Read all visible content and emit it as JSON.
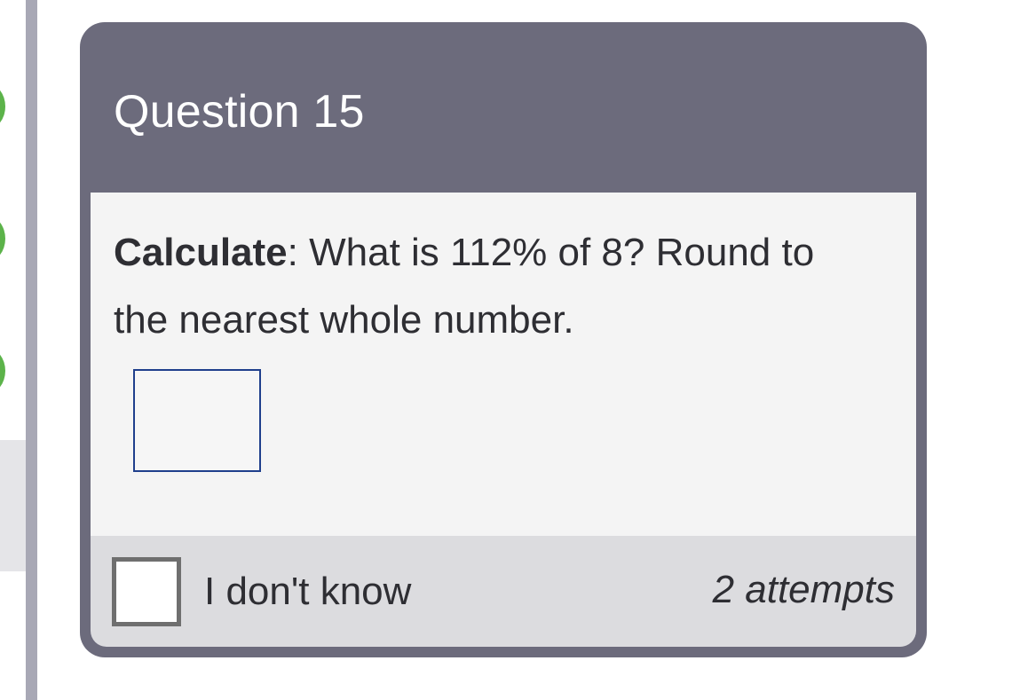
{
  "question": {
    "title": "Question 15",
    "prompt_label": "Calculate",
    "prompt_separator": ":",
    "prompt_text": " What is 112% of 8? Round to the nearest whole number.",
    "answer_value": "",
    "answer_placeholder": ""
  },
  "footer": {
    "idk_label": "I don't know",
    "idk_checked": false,
    "attempts_text": "2 attempts"
  },
  "sidebar": {
    "progress_markers": [
      {
        "status": "correct",
        "color": "#5cb34a"
      },
      {
        "status": "correct",
        "color": "#5cb34a"
      },
      {
        "status": "correct",
        "color": "#5cb34a"
      }
    ]
  },
  "colors": {
    "card_header": "#6c6b7c",
    "card_body": "#f4f4f4",
    "card_footer": "#dcdcdf",
    "input_border": "#1f3f8c",
    "sidebar_divider": "#a8a8b5"
  }
}
